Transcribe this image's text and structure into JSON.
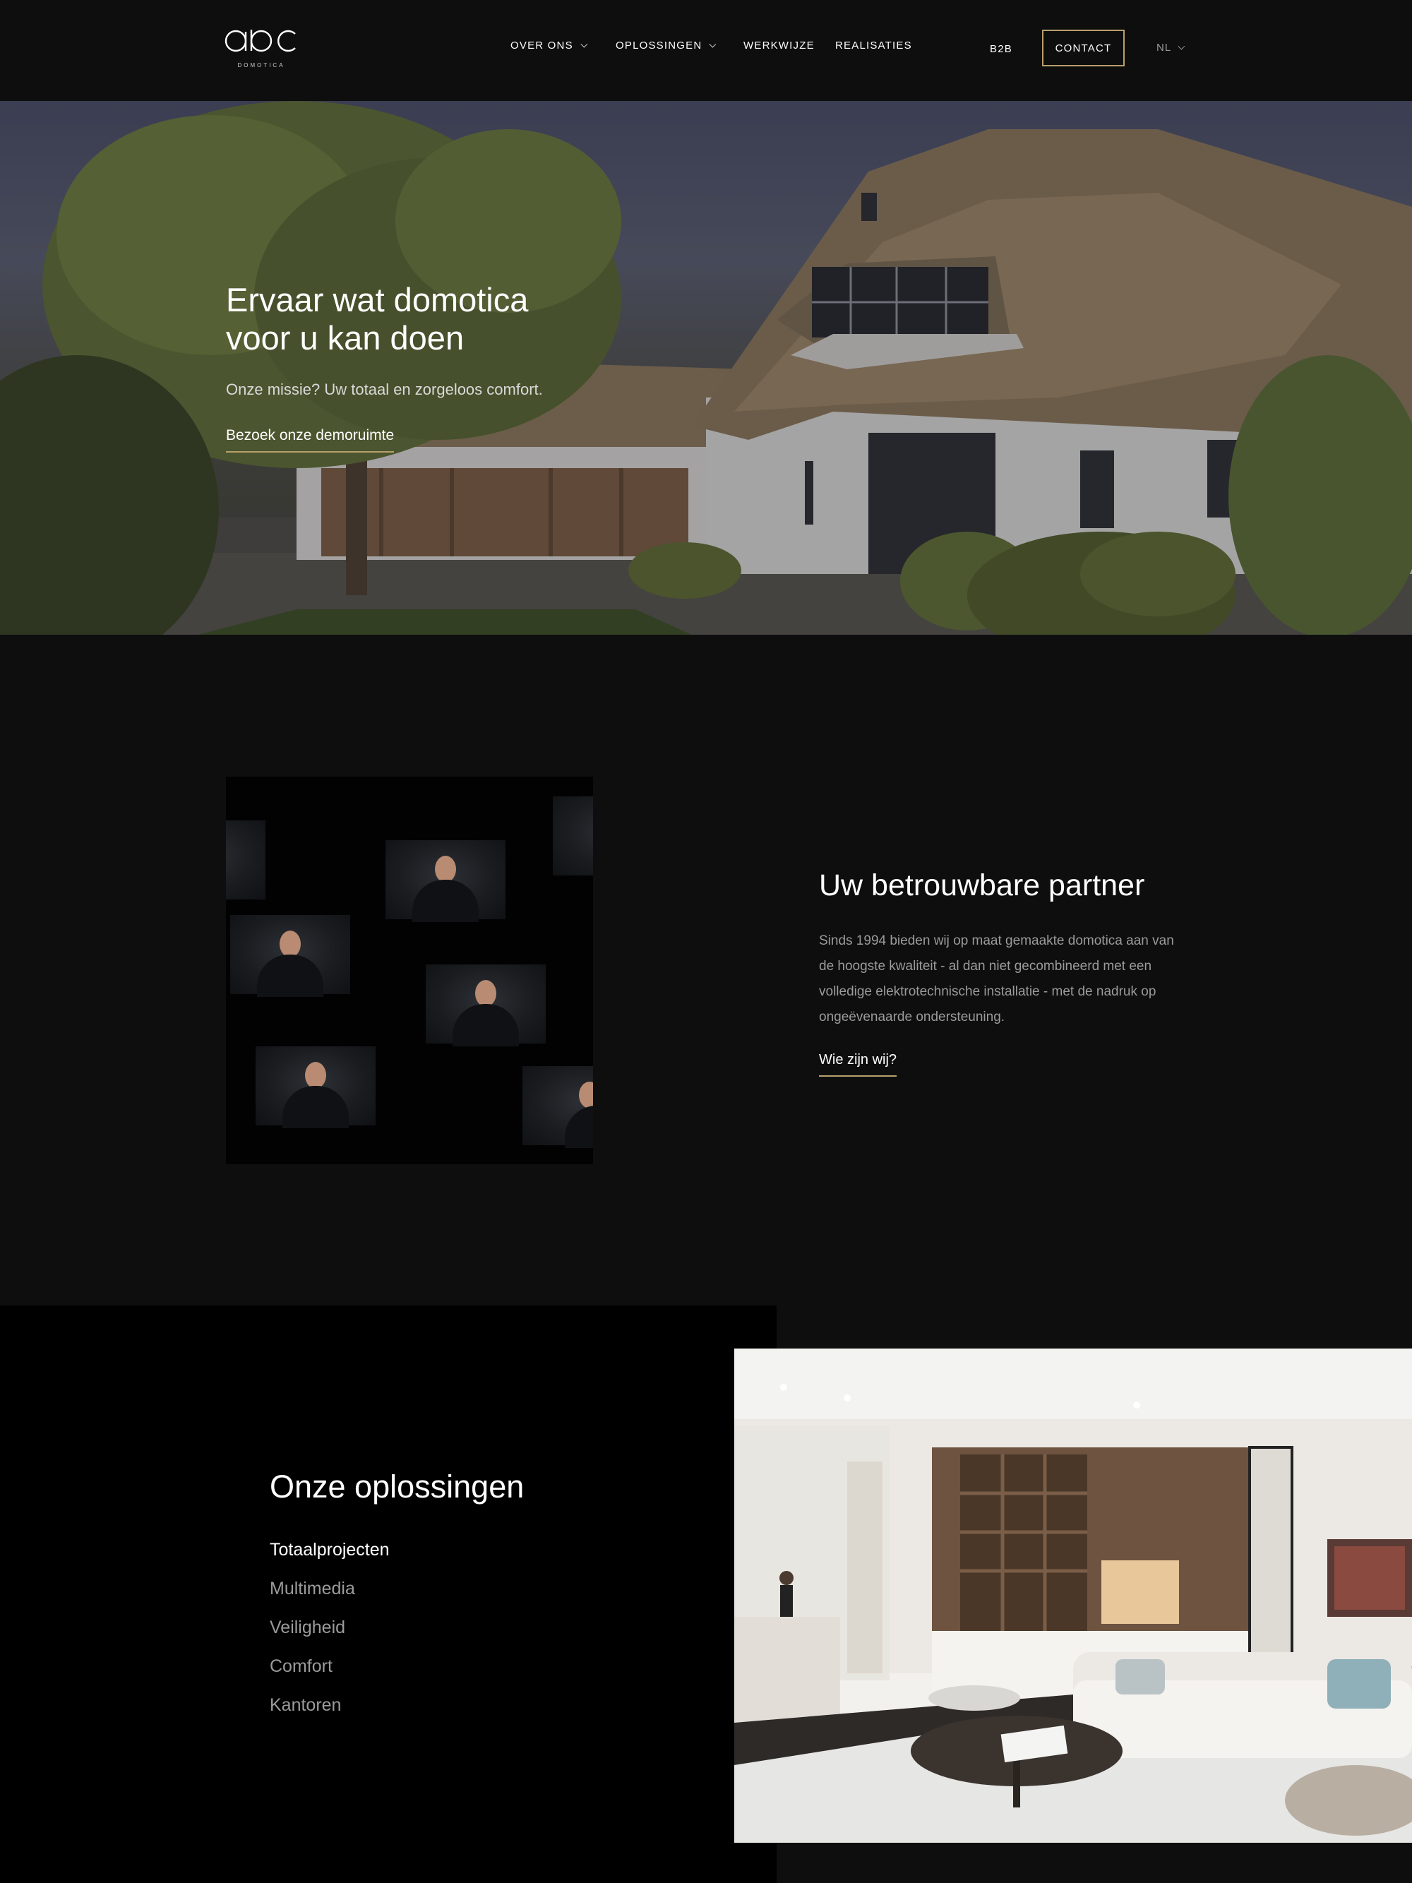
{
  "brand": {
    "logo_text": "abc",
    "logo_sub": "DOMOTICA"
  },
  "nav": {
    "items": [
      {
        "label": "OVER ONS",
        "has_dropdown": true
      },
      {
        "label": "OPLOSSINGEN",
        "has_dropdown": true
      },
      {
        "label": "WERKWIJZE",
        "has_dropdown": false
      },
      {
        "label": "REALISATIES",
        "has_dropdown": false
      }
    ],
    "b2b": "B2B",
    "contact": "CONTACT",
    "language": "NL"
  },
  "hero": {
    "title": "Ervaar wat domotica voor u kan doen",
    "subtitle": "Onze missie? Uw totaal en zorgeloos comfort.",
    "link": "Bezoek onze demoruimte"
  },
  "partner": {
    "title": "Uw betrouwbare partner",
    "text": "Sinds 1994 bieden wij op maat gemaakte domotica aan van de hoogste kwaliteit - al dan niet gecombineerd met een volledige elektrotechnische installatie - met de nadruk op ongeëvenaarde ondersteuning.",
    "link": "Wie zijn wij?"
  },
  "solutions": {
    "title": "Onze oplossingen",
    "items": [
      "Totaalprojecten",
      "Multimedia",
      "Veiligheid",
      "Comfort",
      "Kantoren"
    ],
    "active_index": 0
  },
  "colors": {
    "accent": "#b8a06a",
    "background": "#0e0e0f",
    "panel": "#000000",
    "muted_text": "#9b9b9b"
  }
}
